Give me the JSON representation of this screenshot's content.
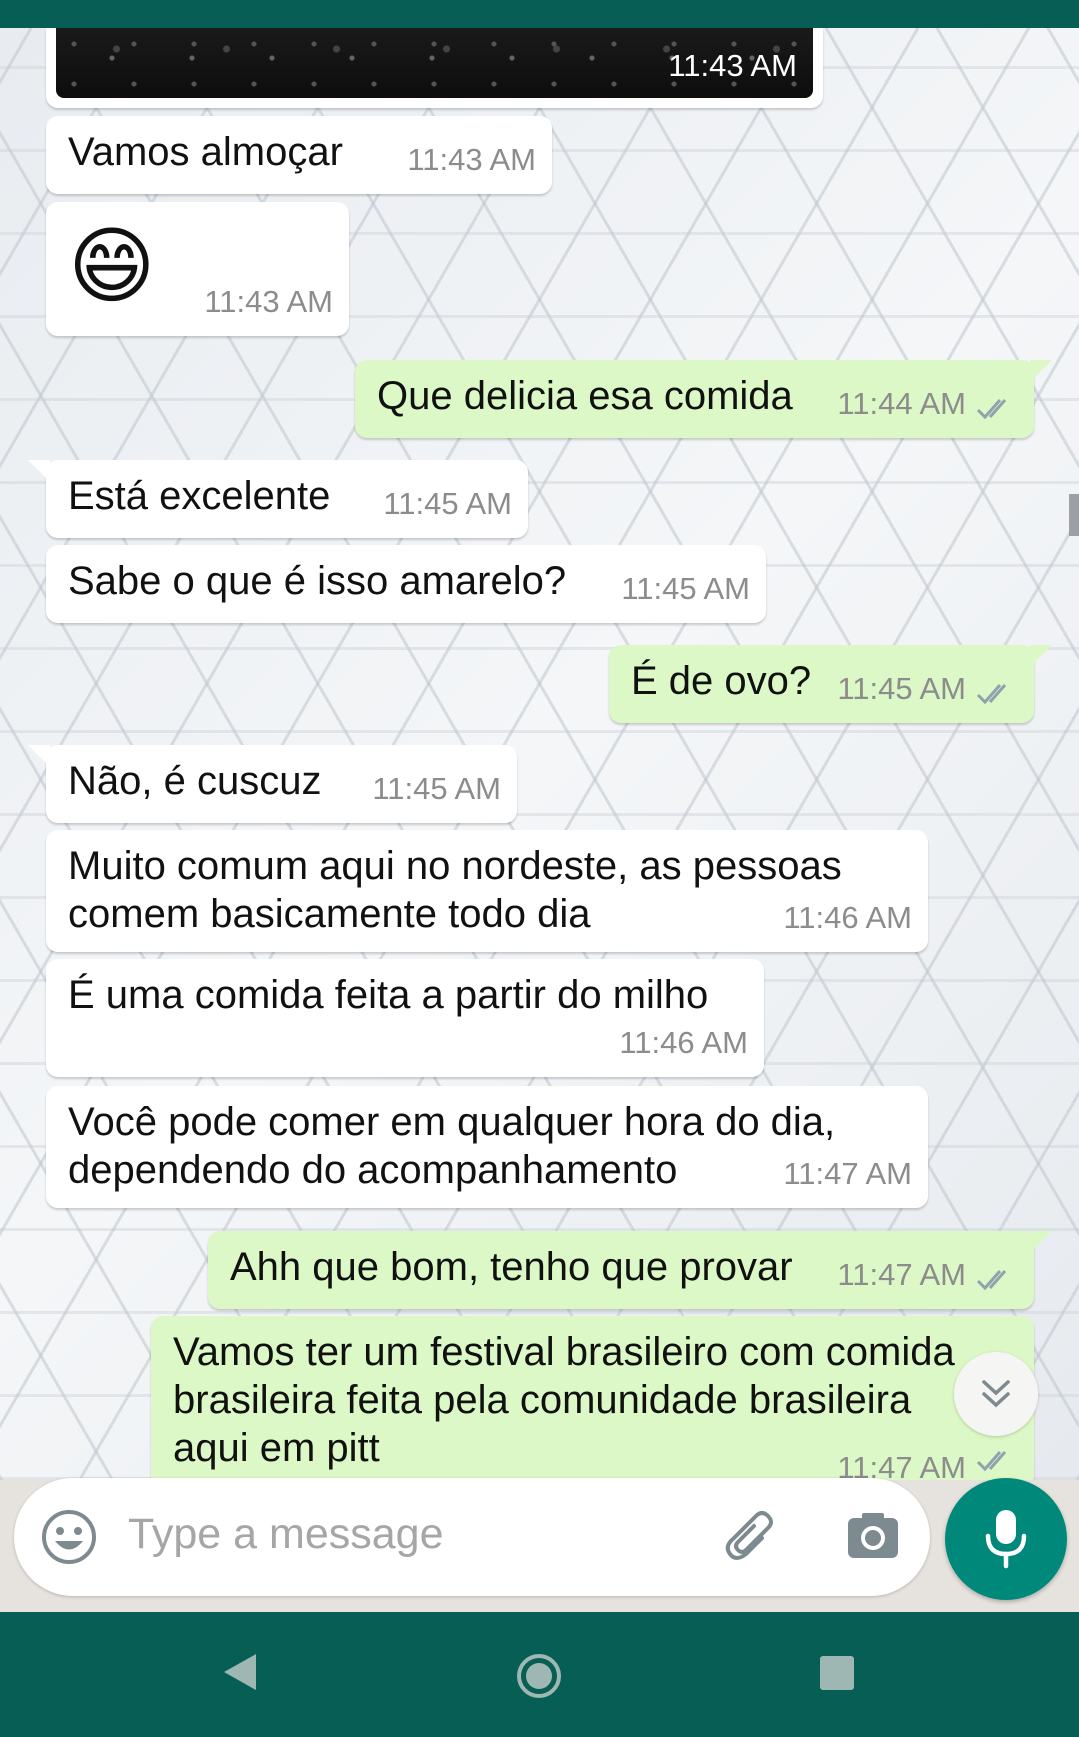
{
  "image_message": {
    "time": "11:43 AM"
  },
  "messages": [
    {
      "direction": "in",
      "text": "Vamos almoçar",
      "time": "11:43 AM"
    },
    {
      "direction": "in",
      "emoji": "😄",
      "time": "11:43 AM"
    },
    {
      "direction": "out",
      "text": "Que delicia esa comida",
      "time": "11:44 AM",
      "status": "read"
    },
    {
      "direction": "in",
      "text": "Está excelente",
      "time": "11:45 AM"
    },
    {
      "direction": "in",
      "text": "Sabe o que é isso amarelo?",
      "time": "11:45 AM"
    },
    {
      "direction": "out",
      "text": "É de ovo?",
      "time": "11:45 AM",
      "status": "read"
    },
    {
      "direction": "in",
      "text": "Não, é cuscuz",
      "time": "11:45 AM"
    },
    {
      "direction": "in",
      "text": "Muito comum aqui no nordeste, as pessoas\ncomem basicamente todo dia",
      "time": "11:46 AM"
    },
    {
      "direction": "in",
      "text": "É uma comida feita a partir do milho",
      "time": "11:46 AM"
    },
    {
      "direction": "in",
      "text": "Você pode comer em qualquer hora do dia,\ndependendo do acompanhamento",
      "time": "11:47 AM"
    },
    {
      "direction": "out",
      "text": "Ahh que bom, tenho que provar",
      "time": "11:47 AM",
      "status": "read"
    },
    {
      "direction": "out",
      "text": "Vamos ter um festival brasileiro com comida\nbrasileira feita pela comunidade brasileira\naqui em pitt",
      "time": "11:47 AM",
      "status": "read"
    }
  ],
  "composer": {
    "placeholder": "Type a message"
  },
  "colors": {
    "header": "#075e54",
    "incoming_bubble": "#ffffff",
    "outgoing_bubble": "#dcf8c6",
    "accent": "#00897b",
    "read_ticks": "#8fa3ad"
  },
  "icons": [
    "emoji-icon",
    "attach-icon",
    "camera-icon",
    "mic-icon",
    "scroll-down-icon",
    "back-icon",
    "home-icon",
    "recents-icon",
    "double-check-icon"
  ]
}
